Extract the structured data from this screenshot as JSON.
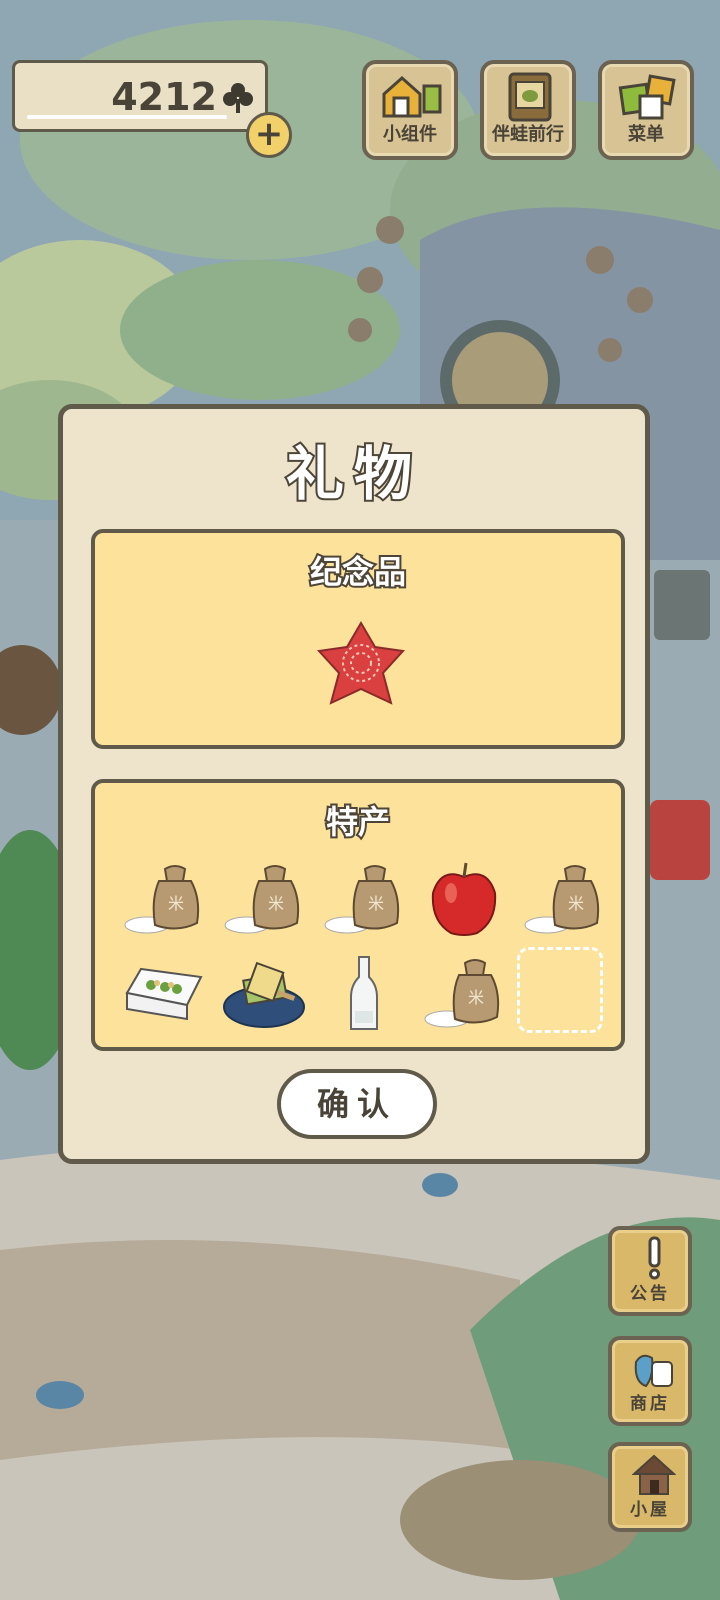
{
  "currency": {
    "amount": "4212",
    "icon": "clover-icon",
    "plus_label": "+"
  },
  "top_buttons": [
    {
      "label": "小组件",
      "icon": "widget-icon"
    },
    {
      "label": "伴蛙前行",
      "icon": "album-icon"
    },
    {
      "label": "菜单",
      "icon": "menu-icon"
    }
  ],
  "dialog": {
    "title": "礼物",
    "souvenir": {
      "title": "纪念品",
      "items": [
        "red-furoshiki-icon"
      ]
    },
    "specialty": {
      "title": "特产",
      "items": [
        "rice-bag-icon",
        "rice-bag-icon",
        "rice-bag-icon",
        "apple-icon",
        "rice-bag-icon",
        "bento-box-icon",
        "popsicle-plate-icon",
        "glass-bottle-icon",
        "rice-bag-icon",
        "empty-slot"
      ]
    },
    "confirm_label": "确认"
  },
  "side_buttons": [
    {
      "label": "公告",
      "icon": "exclamation-icon"
    },
    {
      "label": "商店",
      "icon": "shop-bag-icon"
    },
    {
      "label": "小屋",
      "icon": "house-icon"
    }
  ],
  "colors": {
    "dialog_bg": "#eee4cc",
    "section_bg": "#fde29b",
    "outline": "#5f5a4a",
    "button_wood": "#d7c394"
  }
}
